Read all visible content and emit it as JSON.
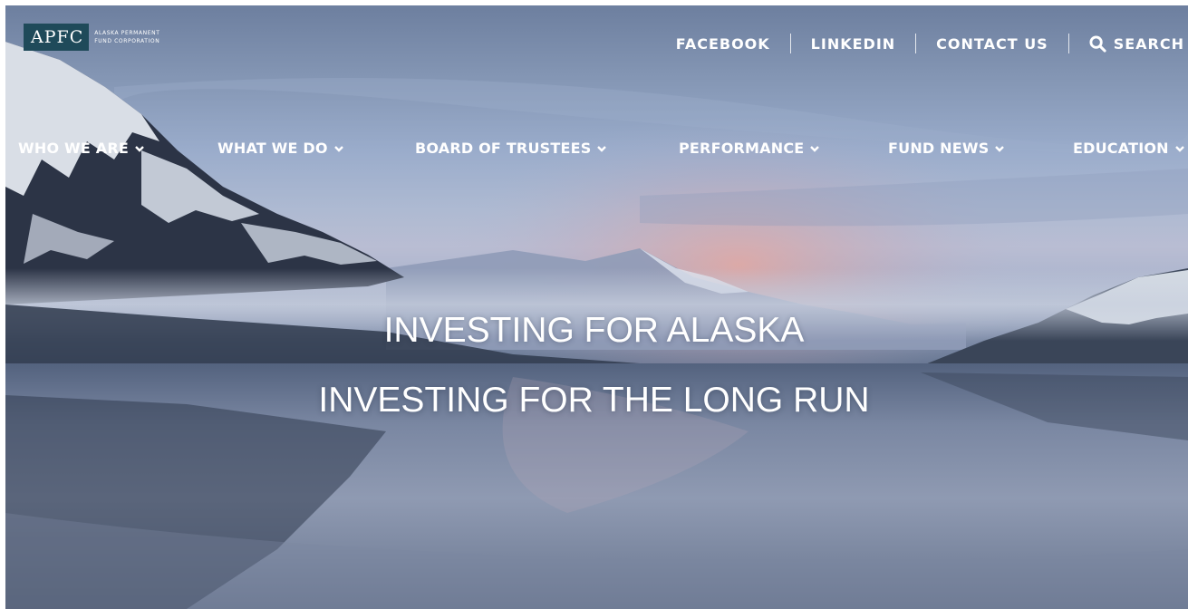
{
  "logo": {
    "mark": "APFC",
    "sub_line1": "ALASKA PERMANENT",
    "sub_line2": "FUND CORPORATION"
  },
  "utility_nav": {
    "facebook": "FACEBOOK",
    "linkedin": "LINKEDIN",
    "contact": "CONTACT US",
    "search": "SEARCH"
  },
  "main_nav": {
    "items": [
      {
        "label": "WHO WE ARE"
      },
      {
        "label": "WHAT WE DO"
      },
      {
        "label": "BOARD OF TRUSTEES"
      },
      {
        "label": "PERFORMANCE"
      },
      {
        "label": "FUND NEWS"
      },
      {
        "label": "EDUCATION"
      }
    ]
  },
  "hero": {
    "headline_line1": "INVESTING FOR ALASKA",
    "headline_line2": "INVESTING FOR THE LONG RUN"
  },
  "colors": {
    "logo_bg": "#1f4a5a",
    "nav_text": "#ffffff"
  },
  "icons": {
    "search": "search-icon",
    "dropdown": "chevron-down-icon"
  }
}
